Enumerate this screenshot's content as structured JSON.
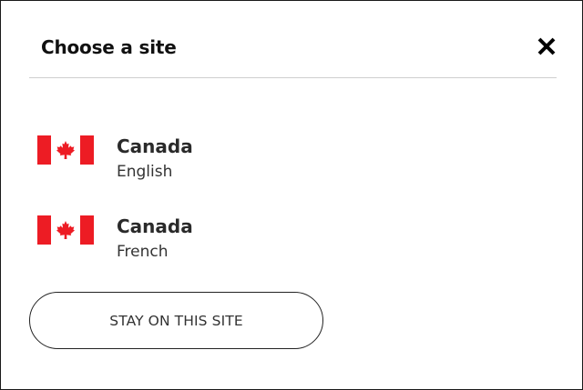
{
  "dialog": {
    "title": "Choose a site",
    "close_icon": "close-icon"
  },
  "sites": [
    {
      "country": "Canada",
      "language": "English",
      "flag_icon": "canada-flag-icon"
    },
    {
      "country": "Canada",
      "language": "French",
      "flag_icon": "canada-flag-icon"
    }
  ],
  "actions": {
    "stay_label": "STAY ON THIS SITE"
  },
  "colors": {
    "flag_red": "#ed1c24",
    "border": "#1a1a1a",
    "divider": "#cfcfcf"
  }
}
